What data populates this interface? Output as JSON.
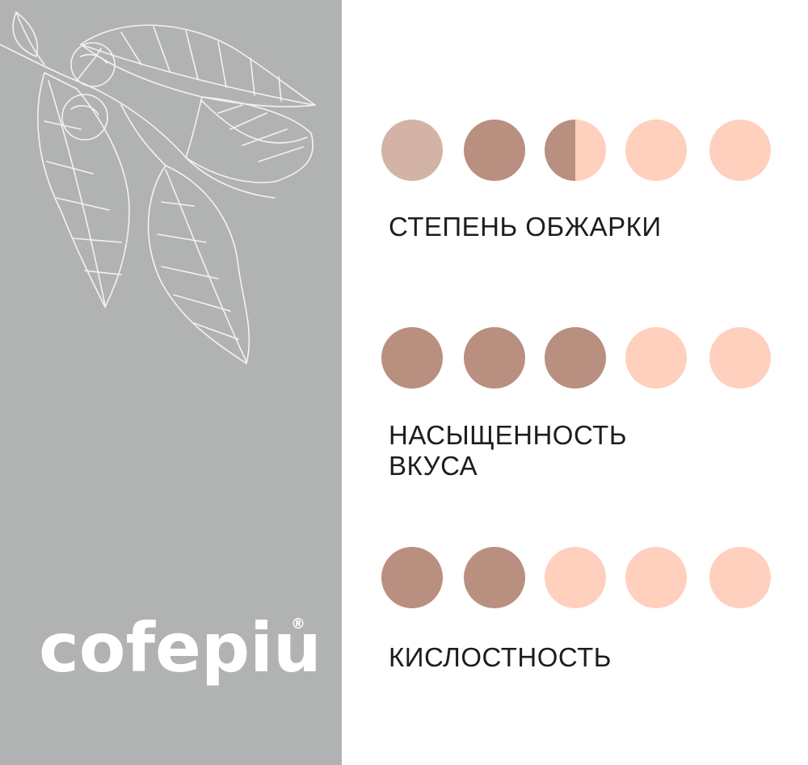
{
  "brand": {
    "name": "cofepiu",
    "registered_mark": "®"
  },
  "colors": {
    "panel_bg": "#b1b3b2",
    "filled": "#b98f7f",
    "light_filled": "#d2b3a5",
    "empty": "#ffd0bd",
    "text": "#1d1d1b"
  },
  "scales": [
    {
      "label": "СТЕПЕНЬ  ОБЖАРКИ",
      "rating": 2.5,
      "max": 5
    },
    {
      "label_line1": "НАСЫЩЕННОСТЬ",
      "label_line2": "ВКУСА",
      "rating": 3,
      "max": 5
    },
    {
      "label": "КИСЛОСТНОСТЬ",
      "rating": 2,
      "max": 5
    }
  ]
}
